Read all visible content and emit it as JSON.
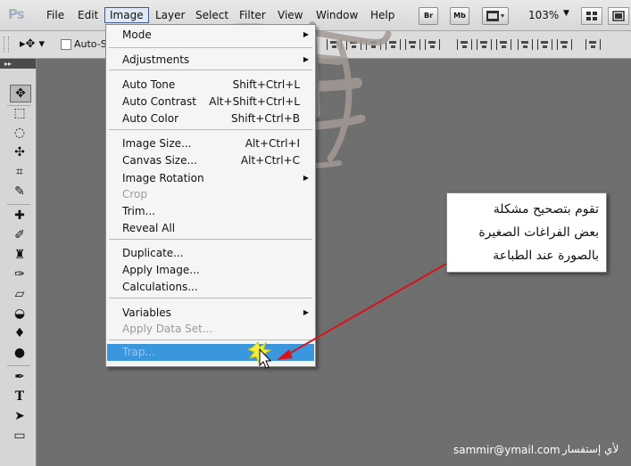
{
  "app": {
    "logo": "Ps"
  },
  "menubar": {
    "items": [
      "File",
      "Edit",
      "Image",
      "Layer",
      "Select",
      "Filter",
      "View",
      "Window",
      "Help"
    ],
    "bridge_button": "Br",
    "minibridge_button": "Mb",
    "zoom": "103%"
  },
  "options_bar": {
    "auto_select_label": "Auto-Se"
  },
  "image_menu": {
    "group1": [
      {
        "label": "Mode",
        "submenu": true
      },
      {
        "label": "Adjustments",
        "submenu": true
      }
    ],
    "group2": [
      {
        "label": "Auto Tone",
        "shortcut": "Shift+Ctrl+L"
      },
      {
        "label": "Auto Contrast",
        "shortcut": "Alt+Shift+Ctrl+L"
      },
      {
        "label": "Auto Color",
        "shortcut": "Shift+Ctrl+B"
      }
    ],
    "group3": [
      {
        "label": "Image Size...",
        "shortcut": "Alt+Ctrl+I"
      },
      {
        "label": "Canvas Size...",
        "shortcut": "Alt+Ctrl+C"
      },
      {
        "label": "Image Rotation",
        "submenu": true
      },
      {
        "label": "Crop",
        "disabled": true
      },
      {
        "label": "Trim..."
      },
      {
        "label": "Reveal All"
      }
    ],
    "group4": [
      {
        "label": "Duplicate..."
      },
      {
        "label": "Apply Image..."
      },
      {
        "label": "Calculations..."
      }
    ],
    "group5": [
      {
        "label": "Variables",
        "submenu": true
      },
      {
        "label": "Apply Data Set...",
        "disabled": true
      }
    ],
    "highlighted": {
      "label": "Trap...",
      "disabled": true
    }
  },
  "callout": {
    "lines": [
      "تقوم بتصحيح مشكلة",
      "بعض الفراغات الصغيرة",
      "بالصورة عند الطباعة"
    ]
  },
  "footer": {
    "email": "sammir@ymail.com",
    "label": "لأي إستفسار"
  },
  "colors": {
    "workspace": "#6f6f6f",
    "menu_highlight": "#3a96dd",
    "arrow": "#d8141b"
  },
  "icons": [
    "move-tool-icon",
    "marquee-tool-icon",
    "lasso-tool-icon",
    "quick-selection-icon",
    "crop-tool-icon",
    "eyedropper-icon",
    "healing-brush-icon",
    "brush-icon",
    "clone-stamp-icon",
    "history-brush-icon",
    "eraser-icon",
    "gradient-icon",
    "blur-icon",
    "dodge-icon",
    "pen-tool-icon",
    "type-tool-icon",
    "path-selection-icon",
    "rectangle-tool-icon"
  ]
}
